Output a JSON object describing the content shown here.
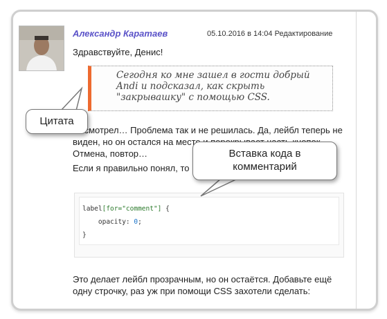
{
  "comment": {
    "author": "Александр Каратаев",
    "meta": "05.10.2016 в 14:04 Редактирование",
    "greeting": "Здравствуйте, Денис!",
    "quote": "Сегодня ко мне зашел в гости добрый Andi и подсказал, как скрыть \"закрывашку\" с помощью CSS.",
    "paragraph1": "Посмотрел… Проблема так и не решилась. Да, лейбл теперь не виден, но он остался на месте и перекрывает часть кнопок. Отмена, повтор…",
    "paragraph2": "Если я правильно понял, то надо добавить эту строчку:",
    "code_selector": "label",
    "code_attr": "[for=\"comment\"]",
    "code_open": " {",
    "code_prop": "    opacity: ",
    "code_val": "0",
    "code_semicolon": ";",
    "code_close": "}",
    "paragraph3": "Это делает лейбл прозрачным, но он остаётся. Добавьте ещё одну строчку, раз уж при помощи CSS захотели сделать:"
  },
  "callouts": {
    "quote_label": "Цитата",
    "code_label_line1": "Вставка кода в",
    "code_label_line2": "комментарий"
  },
  "colors": {
    "author": "#5a52c8",
    "quote_border": "#ee6a2f"
  }
}
